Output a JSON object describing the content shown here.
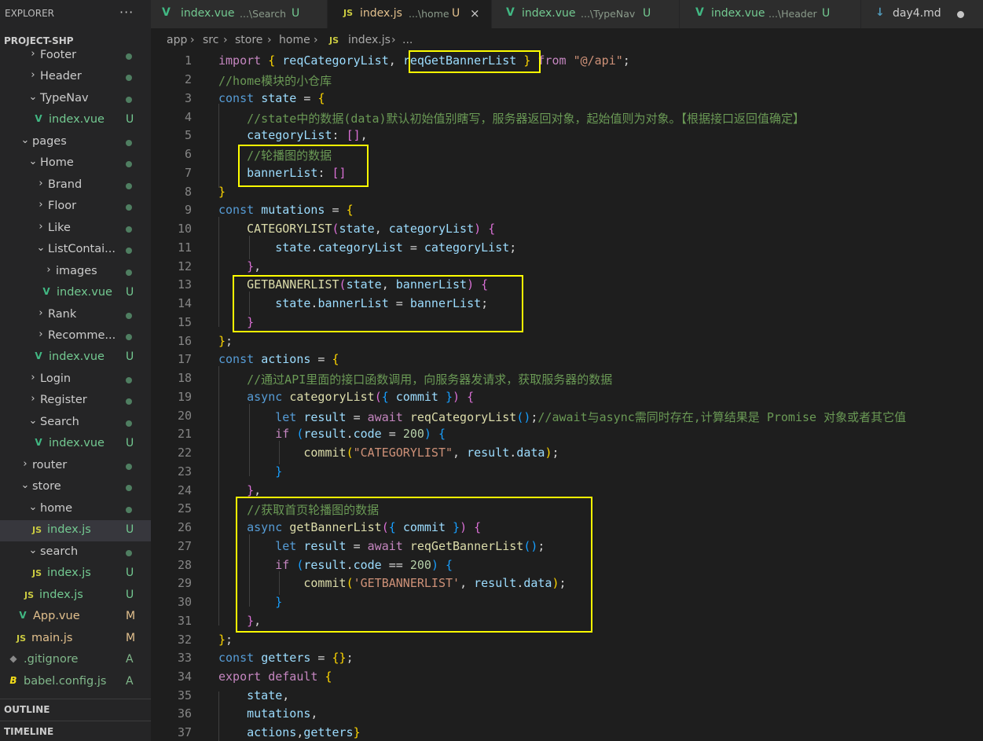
{
  "explorer": {
    "title": "EXPLORER",
    "more": "···",
    "project": "PROJECT-SHP",
    "outline": "OUTLINE",
    "timeline": "TIMELINE",
    "items": [
      {
        "label": "Footer",
        "chev": "›",
        "icon": "",
        "status": ""
      },
      {
        "label": "Header",
        "chev": "›",
        "icon": "",
        "status": ""
      },
      {
        "label": "TypeNav",
        "chev": "⌄",
        "icon": "",
        "status": ""
      },
      {
        "label": "index.vue",
        "chev": "",
        "icon": "V",
        "status": "U"
      },
      {
        "label": "pages",
        "chev": "⌄",
        "icon": "",
        "status": ""
      },
      {
        "label": "Home",
        "chev": "⌄",
        "icon": "",
        "status": ""
      },
      {
        "label": "Brand",
        "chev": "›",
        "icon": "",
        "status": ""
      },
      {
        "label": "Floor",
        "chev": "›",
        "icon": "",
        "status": ""
      },
      {
        "label": "Like",
        "chev": "›",
        "icon": "",
        "status": ""
      },
      {
        "label": "ListContai...",
        "chev": "⌄",
        "icon": "",
        "status": ""
      },
      {
        "label": "images",
        "chev": "›",
        "icon": "",
        "status": ""
      },
      {
        "label": "index.vue",
        "chev": "",
        "icon": "V",
        "status": "U"
      },
      {
        "label": "Rank",
        "chev": "›",
        "icon": "",
        "status": ""
      },
      {
        "label": "Recomme...",
        "chev": "›",
        "icon": "",
        "status": ""
      },
      {
        "label": "index.vue",
        "chev": "",
        "icon": "V",
        "status": "U"
      },
      {
        "label": "Login",
        "chev": "›",
        "icon": "",
        "status": ""
      },
      {
        "label": "Register",
        "chev": "›",
        "icon": "",
        "status": ""
      },
      {
        "label": "Search",
        "chev": "⌄",
        "icon": "",
        "status": ""
      },
      {
        "label": "index.vue",
        "chev": "",
        "icon": "V",
        "status": "U"
      },
      {
        "label": "router",
        "chev": "›",
        "icon": "",
        "status": ""
      },
      {
        "label": "store",
        "chev": "⌄",
        "icon": "",
        "status": ""
      },
      {
        "label": "home",
        "chev": "⌄",
        "icon": "",
        "status": ""
      },
      {
        "label": "index.js",
        "chev": "",
        "icon": "JS",
        "status": "U"
      },
      {
        "label": "search",
        "chev": "⌄",
        "icon": "",
        "status": ""
      },
      {
        "label": "index.js",
        "chev": "",
        "icon": "JS",
        "status": "U"
      },
      {
        "label": "index.js",
        "chev": "",
        "icon": "JS",
        "status": "U"
      },
      {
        "label": "App.vue",
        "chev": "",
        "icon": "V",
        "status": "M"
      },
      {
        "label": "main.js",
        "chev": "",
        "icon": "JS",
        "status": "M"
      },
      {
        "label": ".gitignore",
        "chev": "",
        "icon": "◆",
        "status": "A"
      },
      {
        "label": "babel.config.js",
        "chev": "",
        "icon": "B",
        "status": "A"
      }
    ]
  },
  "tabs": [
    {
      "icon": "V",
      "name": "index.vue",
      "path": "...\\Search",
      "status": "U"
    },
    {
      "icon": "JS",
      "name": "index.js",
      "path": "...\\home",
      "status": "U",
      "close": "×"
    },
    {
      "icon": "V",
      "name": "index.vue",
      "path": "...\\TypeNav",
      "status": "U"
    },
    {
      "icon": "V",
      "name": "index.vue",
      "path": "...\\Header",
      "status": "U"
    },
    {
      "icon": "↓",
      "name": "day4.md",
      "path": "",
      "status": ""
    }
  ],
  "breadcrumb": {
    "app": "app",
    "src": "src",
    "store": "store",
    "home": "home",
    "icon": "JS",
    "file": "index.js",
    "tail": "...",
    "sep": "›"
  },
  "code": {
    "lines": [
      "1",
      "2",
      "3",
      "4",
      "5",
      "6",
      "7",
      "8",
      "9",
      "10",
      "11",
      "12",
      "13",
      "14",
      "15",
      "16",
      "17",
      "18",
      "19",
      "20",
      "21",
      "22",
      "23",
      "24",
      "25",
      "26",
      "27",
      "28",
      "29",
      "30",
      "31",
      "32",
      "33",
      "34",
      "35",
      "36",
      "37"
    ],
    "t": {
      "import": "import",
      "from": "from",
      "const": "const",
      "async": "async",
      "let": "let",
      "await": "await",
      "if": "if",
      "export": "export",
      "default": "default",
      "reqCategoryList": "reqCategoryList",
      "reqGetBannerList": "reqGetBannerList",
      "api": "\"@/api\"",
      "c2": "//home模块的小仓库",
      "state": "state",
      "mutations": "mutations",
      "actions": "actions",
      "getters": "getters",
      "c4": "//state中的数据(data)默认初始值别瞎写，服务器返回对象，起始值则为对象。【根据接口返回值确定】",
      "categoryList": "categoryList",
      "c6": "//轮播图的数据",
      "bannerList": "bannerList",
      "CATEGORYLIST": "CATEGORYLIST",
      "GETBANNERLIST": "GETBANNERLIST",
      "c18": "//通过API里面的接口函数调用，向服务器发请求，获取服务器的数据",
      "commit": "commit",
      "result": "result",
      "code": "code",
      "data": "data",
      "n200": "200",
      "c20": "//await与async需同时存在,计算结果是 Promise 对象或者其它值",
      "s22": "\"CATEGORYLIST\"",
      "c25": "//获取首页轮播图的数据",
      "getBannerList": "getBannerList",
      "s29": "'GETBANNERLIST'"
    }
  }
}
